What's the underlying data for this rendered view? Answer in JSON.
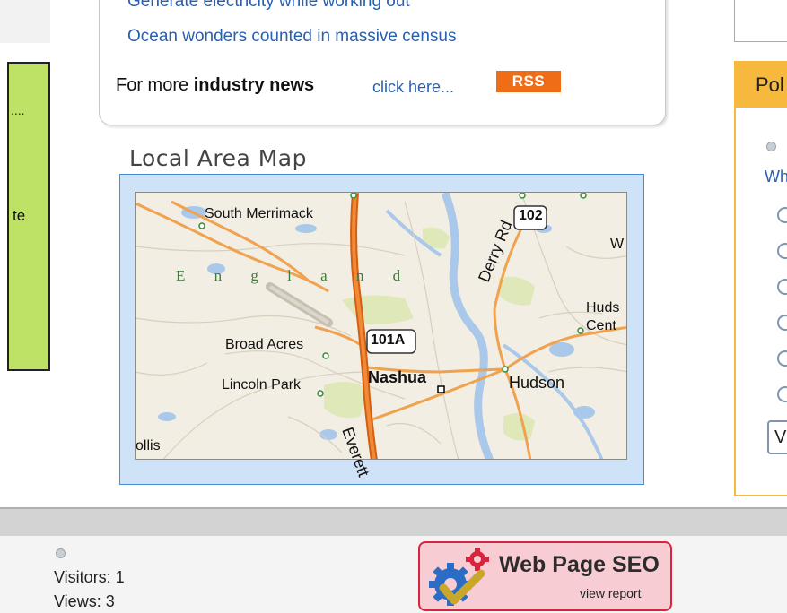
{
  "news": {
    "links": [
      "Generate electricity while working out",
      "Ocean wonders counted in massive census"
    ],
    "more_prefix": "For more ",
    "more_bold": "industry news",
    "click_here": "click here...",
    "rss": "RSS"
  },
  "left_panel": {
    "dots": "....",
    "fragment": "te"
  },
  "map": {
    "title": "Local Area Map",
    "labels": {
      "south_merrimack": "South Merrimack",
      "england": "E n g l a n d",
      "broad_acres": "Broad Acres",
      "lincoln_park": "Lincoln Park",
      "nashua": "Nashua",
      "hudson": "Hudson",
      "hudson_center": "Huds\nCent",
      "derry_rd": "Derry Rd",
      "route_102": "102",
      "route_101a": "101A",
      "everett": "Everett",
      "hollis": "ollis",
      "w": "W"
    }
  },
  "poll": {
    "header": "Pol",
    "question": "Wh",
    "vote_label": "V",
    "option_count": 6
  },
  "footer": {
    "visitors": "Visitors: 1",
    "views": "Views: 3",
    "seo_title": "Web Page SEO",
    "seo_sub": "view report"
  }
}
